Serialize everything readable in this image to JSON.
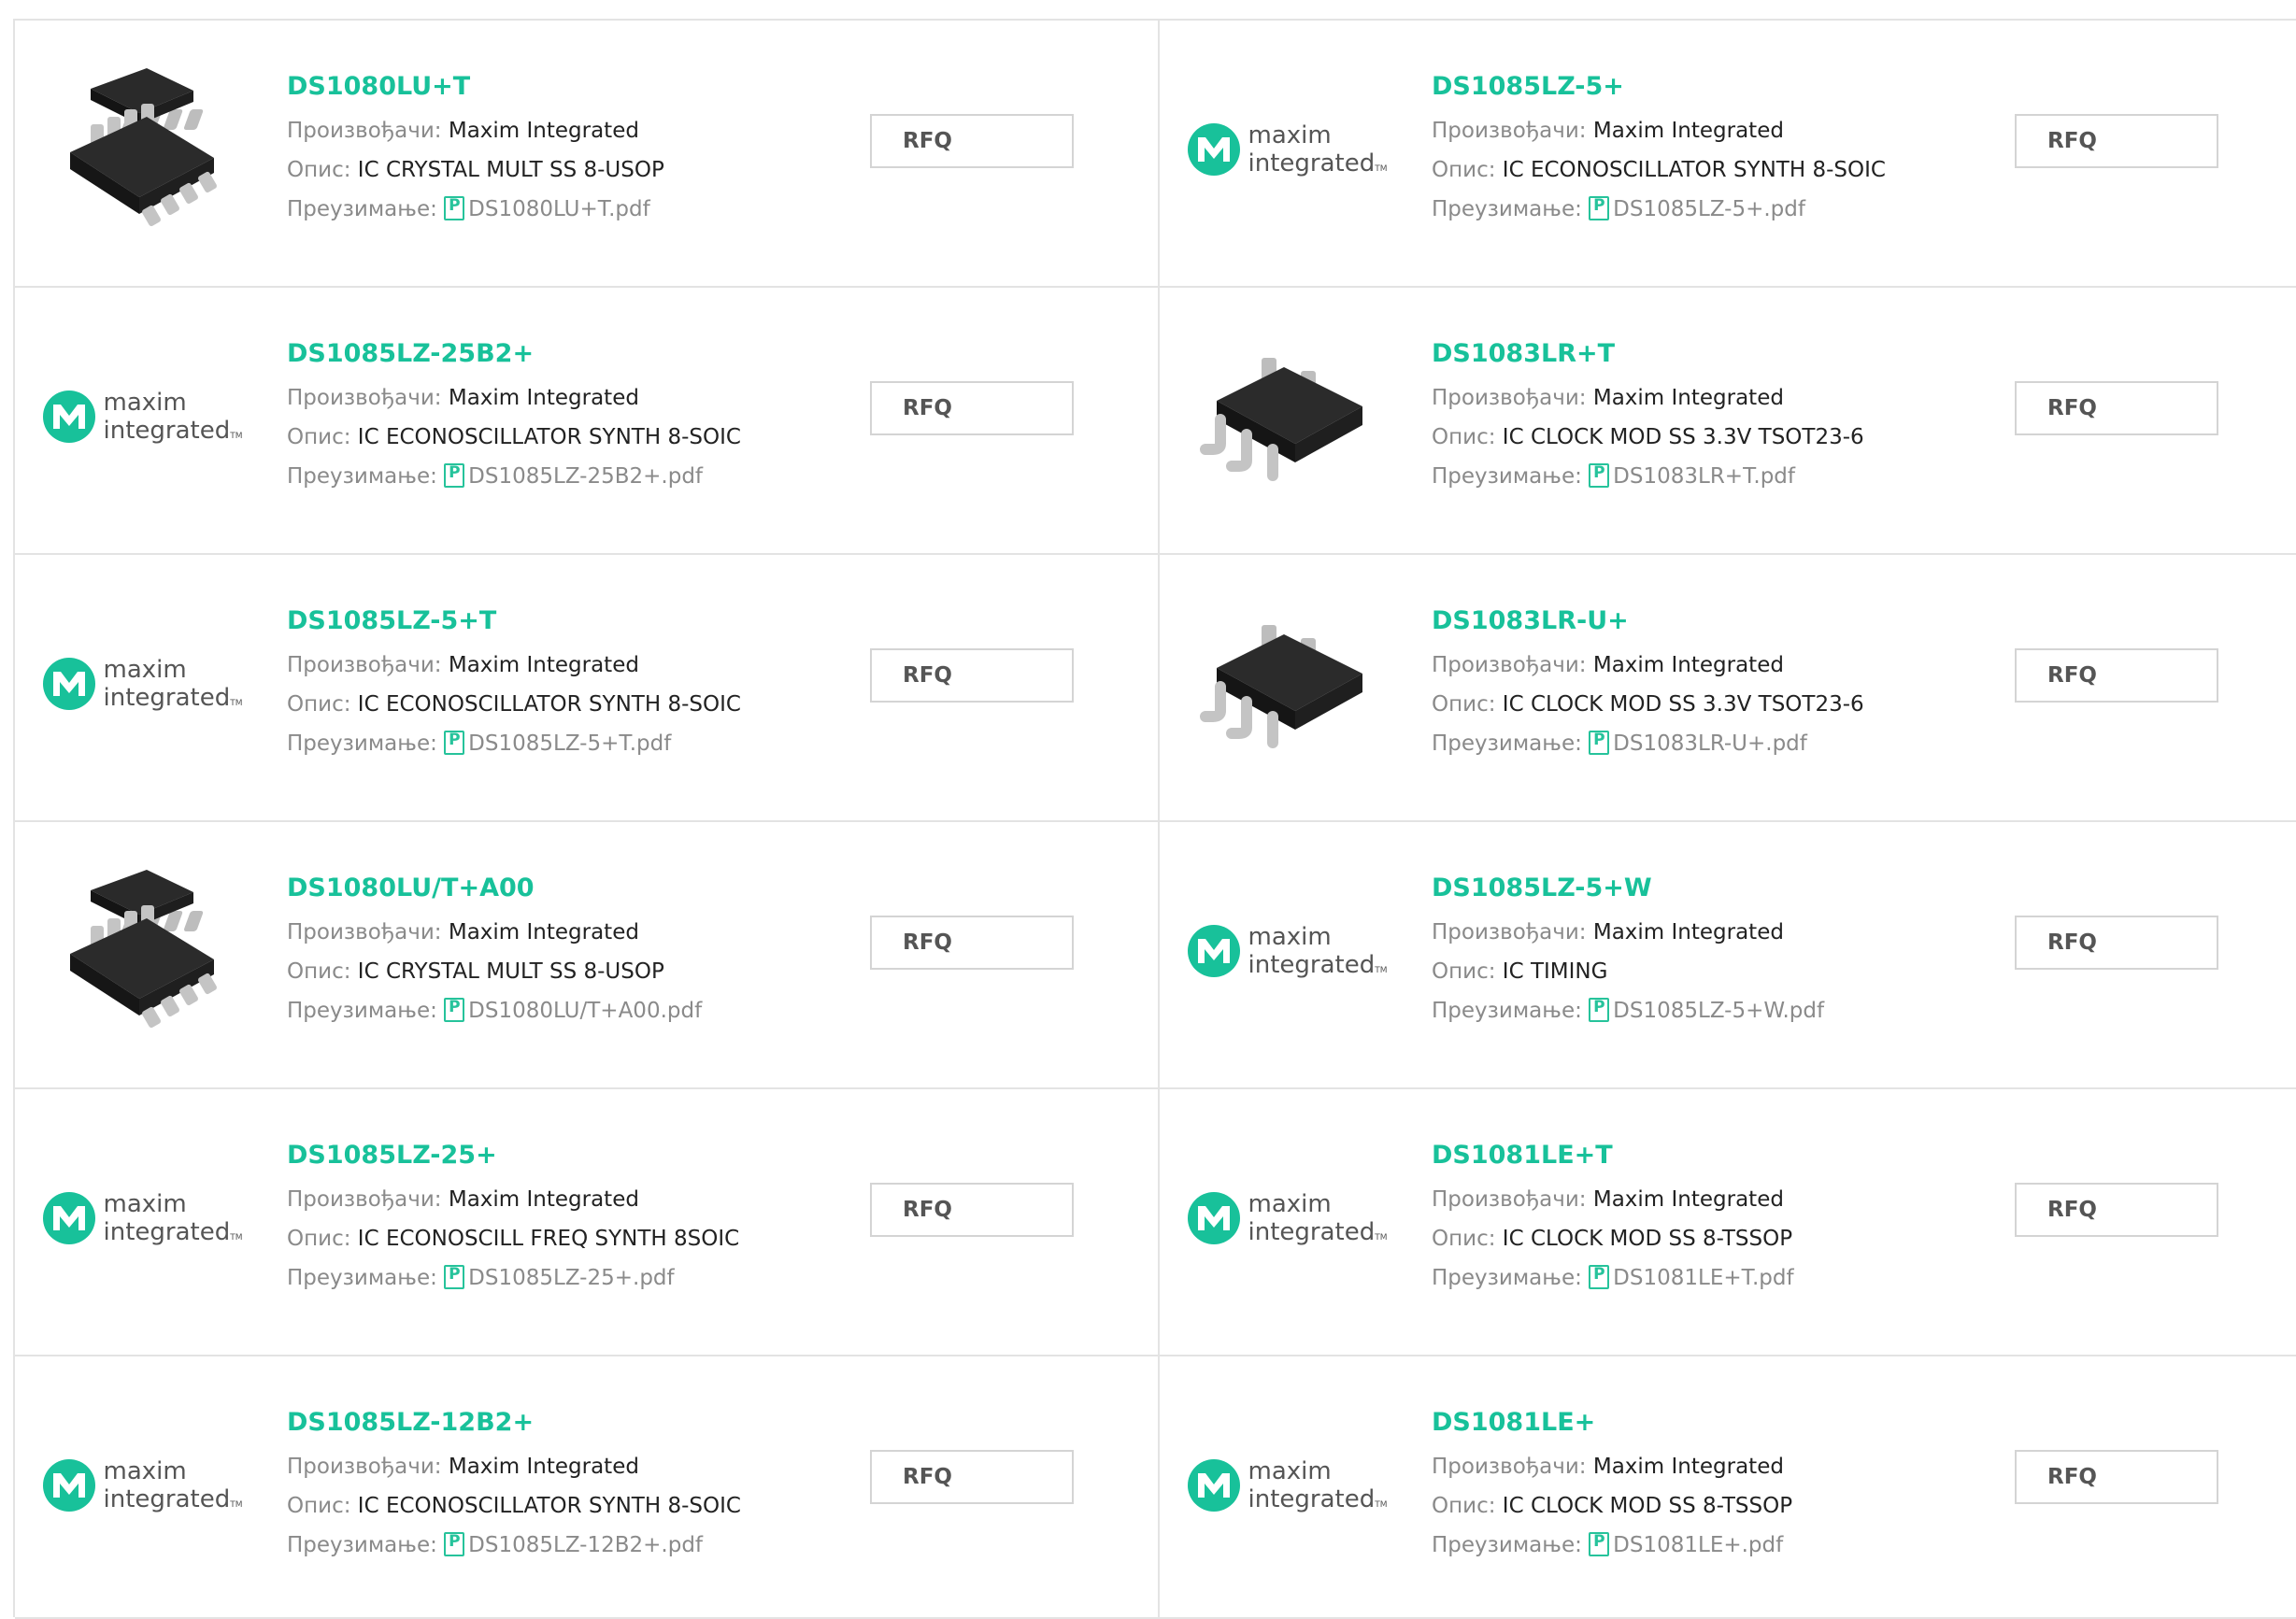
{
  "labels": {
    "manufacturer": "Произвођачи:",
    "description": "Опис:",
    "download": "Преузимање:",
    "rfq": "RFQ"
  },
  "brand": {
    "logo_word1": "maxim",
    "logo_word2": "integrated",
    "logo_tm": "TM",
    "accent_color": "#18c19a"
  },
  "products": [
    {
      "part": "DS1080LU+T",
      "manufacturer": "Maxim Integrated",
      "description": "IC CRYSTAL MULT SS 8-USOP",
      "pdf": "DS1080LU+T.pdf",
      "image": "usop-chip-icon"
    },
    {
      "part": "DS1085LZ-5+",
      "manufacturer": "Maxim Integrated",
      "description": "IC ECONOSCILLATOR SYNTH 8-SOIC",
      "pdf": "DS1085LZ-5+.pdf",
      "image": "maxim-logo"
    },
    {
      "part": "DS1085LZ-25B2+",
      "manufacturer": "Maxim Integrated",
      "description": "IC ECONOSCILLATOR SYNTH 8-SOIC",
      "pdf": "DS1085LZ-25B2+.pdf",
      "image": "maxim-logo"
    },
    {
      "part": "DS1083LR+T",
      "manufacturer": "Maxim Integrated",
      "description": "IC CLOCK MOD SS 3.3V TSOT23-6",
      "pdf": "DS1083LR+T.pdf",
      "image": "tsot-chip-icon"
    },
    {
      "part": "DS1085LZ-5+T",
      "manufacturer": "Maxim Integrated",
      "description": "IC ECONOSCILLATOR SYNTH 8-SOIC",
      "pdf": "DS1085LZ-5+T.pdf",
      "image": "maxim-logo"
    },
    {
      "part": "DS1083LR-U+",
      "manufacturer": "Maxim Integrated",
      "description": "IC CLOCK MOD SS 3.3V TSOT23-6",
      "pdf": "DS1083LR-U+.pdf",
      "image": "tsot-chip-icon"
    },
    {
      "part": "DS1080LU/T+A00",
      "manufacturer": "Maxim Integrated",
      "description": "IC CRYSTAL MULT SS 8-USOP",
      "pdf": "DS1080LU/T+A00.pdf",
      "image": "usop-chip-icon"
    },
    {
      "part": "DS1085LZ-5+W",
      "manufacturer": "Maxim Integrated",
      "description": "IC TIMING",
      "pdf": "DS1085LZ-5+W.pdf",
      "image": "maxim-logo"
    },
    {
      "part": "DS1085LZ-25+",
      "manufacturer": "Maxim Integrated",
      "description": "IC ECONOSCILL FREQ SYNTH 8SOIC",
      "pdf": "DS1085LZ-25+.pdf",
      "image": "maxim-logo"
    },
    {
      "part": "DS1081LE+T",
      "manufacturer": "Maxim Integrated",
      "description": "IC CLOCK MOD SS 8-TSSOP",
      "pdf": "DS1081LE+T.pdf",
      "image": "maxim-logo"
    },
    {
      "part": "DS1085LZ-12B2+",
      "manufacturer": "Maxim Integrated",
      "description": "IC ECONOSCILLATOR SYNTH 8-SOIC",
      "pdf": "DS1085LZ-12B2+.pdf",
      "image": "maxim-logo"
    },
    {
      "part": "DS1081LE+",
      "manufacturer": "Maxim Integrated",
      "description": "IC CLOCK MOD SS 8-TSSOP",
      "pdf": "DS1081LE+.pdf",
      "image": "maxim-logo"
    }
  ]
}
